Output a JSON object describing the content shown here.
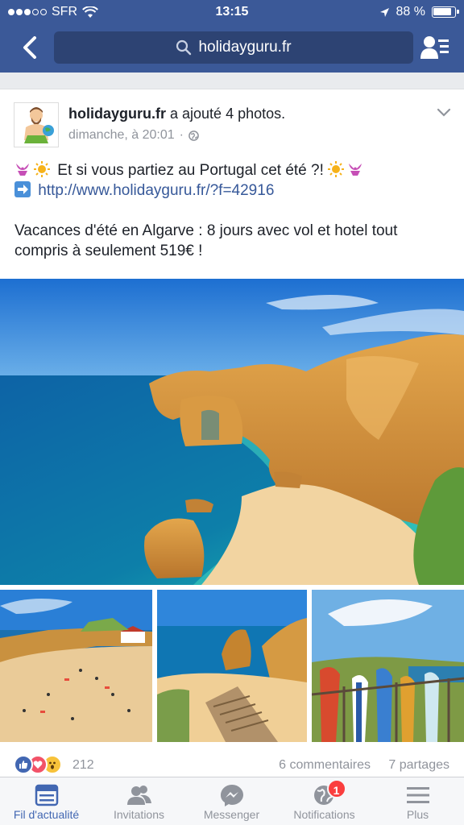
{
  "status_bar": {
    "carrier": "SFR",
    "time": "13:15",
    "battery": "88 %"
  },
  "nav": {
    "url": "holidayguru.fr"
  },
  "post": {
    "author": "holidayguru.fr",
    "action": "a ajouté 4 photos.",
    "timestamp": "dimanche, à 20:01",
    "separator": "·",
    "line1": "Et si vous partiez au Portugal cet été ?!",
    "link": "http://www.holidayguru.fr/?f=42916",
    "line3": "Vacances d'été en Algarve : 8 jours avec vol et hotel tout compris à seulement 519€ !"
  },
  "engagement": {
    "reaction_count": "212",
    "comments": "6 commentaires",
    "shares": "7 partages"
  },
  "tabs": [
    {
      "label": "Fil d'actualité",
      "icon": "news-feed-icon"
    },
    {
      "label": "Invitations",
      "icon": "friends-icon"
    },
    {
      "label": "Messenger",
      "icon": "messenger-icon"
    },
    {
      "label": "Notifications",
      "icon": "globe-icon",
      "badge": "1"
    },
    {
      "label": "Plus",
      "icon": "menu-icon"
    }
  ],
  "colors": {
    "brand": "#3b5998",
    "link": "#365899",
    "active_tab": "#4267b2",
    "badge": "#fa3e3e"
  }
}
